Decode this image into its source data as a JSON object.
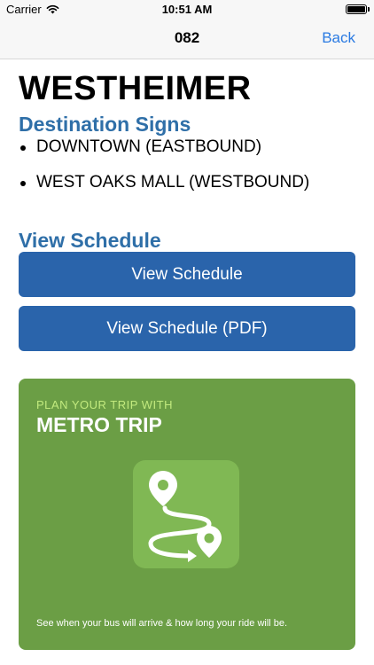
{
  "status_bar": {
    "carrier": "Carrier",
    "time": "10:51 AM"
  },
  "nav": {
    "title": "082",
    "back_label": "Back"
  },
  "route": {
    "name": "WESTHEIMER"
  },
  "destination_signs": {
    "heading": "Destination Signs",
    "items": [
      "DOWNTOWN (EASTBOUND)",
      "WEST OAKS MALL (WESTBOUND)"
    ]
  },
  "schedule": {
    "heading": "View Schedule",
    "view_schedule_label": "View Schedule",
    "view_schedule_pdf_label": "View Schedule (PDF)"
  },
  "promo": {
    "kicker": "PLAN YOUR TRIP WITH",
    "title": "METRO TRIP",
    "footer": "See when your bus will arrive & how long your ride will be.",
    "icon": "metro-trip-app-icon"
  },
  "colors": {
    "accent_blue": "#2a64ab",
    "heading_blue": "#2f6fa8",
    "link_blue": "#2a7ae2",
    "promo_green": "#6b9e45",
    "promo_icon_green": "#80b854",
    "kicker_green": "#c2ea7e"
  }
}
